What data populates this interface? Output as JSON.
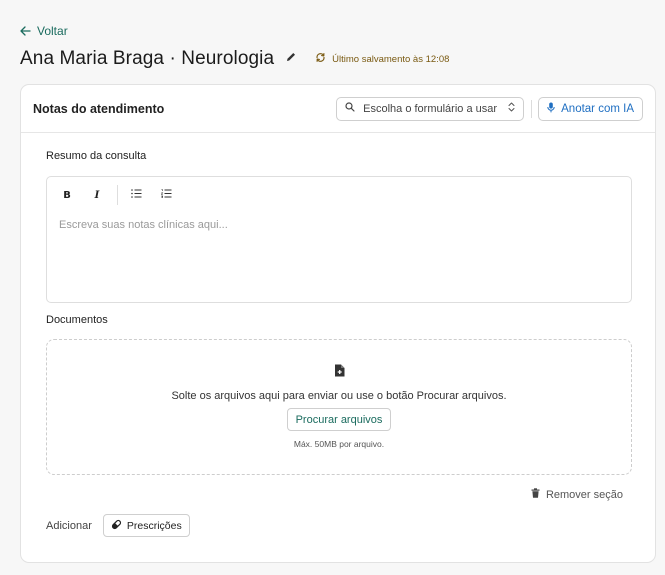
{
  "nav": {
    "back_label": "Voltar"
  },
  "header": {
    "title": "Ana Maria Braga · Neurologia",
    "save_status": "Último salvamento às 12:08"
  },
  "card": {
    "title": "Notas do atendimento",
    "form_select": {
      "placeholder": "Escolha o formulário a usar"
    },
    "ai_button": "Anotar com IA"
  },
  "summary": {
    "label": "Resumo da consulta",
    "toolbar": {
      "bold": "B",
      "italic": "I"
    },
    "placeholder": "Escreva suas notas clínicas aqui..."
  },
  "documents": {
    "label": "Documentos",
    "drop_text": "Solte os arquivos aqui para enviar ou use o botão Procurar arquivos.",
    "browse_button": "Procurar arquivos",
    "limit": "Máx. 50MB por arquivo."
  },
  "remove_section": "Remover seção",
  "add": {
    "label": "Adicionar",
    "prescriptions_button": "Prescrições"
  },
  "colors": {
    "accent_green": "#1a6b5e",
    "ai_blue": "#1f6fc2",
    "save_status": "#7a5a12"
  }
}
